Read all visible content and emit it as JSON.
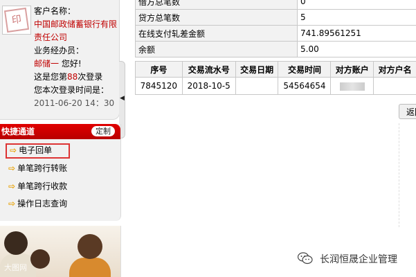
{
  "user": {
    "customer_label": "客户名称：",
    "customer_name": "中国邮政储蓄银行有限责任公司",
    "agent_label": "业务经办员：",
    "agent_name": "邮储一",
    "greeting": " 您好!",
    "visit_prefix": "这是您第",
    "visit_count": "88",
    "visit_suffix": "次登录",
    "last_login_label": "您本次登录时间是：",
    "last_login_time": "2011-06-20 14：30"
  },
  "quick_access": {
    "title": "快捷通道",
    "customize_label": "定制",
    "items": [
      {
        "label": "电子回单",
        "selected": true
      },
      {
        "label": "单笔跨行转账",
        "selected": false
      },
      {
        "label": "单笔跨行收款",
        "selected": false
      },
      {
        "label": "操作日志查询",
        "selected": false
      }
    ]
  },
  "photo": {
    "watermark": "大图网"
  },
  "summary": {
    "rows": [
      {
        "label": "借方总笔数",
        "value": "0"
      },
      {
        "label": "贷方总笔数",
        "value": "5"
      },
      {
        "label": "在线支付轧差金额",
        "value": "741.89561251"
      },
      {
        "label": "余额",
        "value": "5.00"
      }
    ]
  },
  "transactions": {
    "columns": [
      "序号",
      "交易流水号",
      "交易日期",
      "交易时间",
      "对方账户",
      "对方户名"
    ],
    "rows": [
      {
        "seq": "7845120",
        "serial": "2018-10-5",
        "date": "",
        "time": "54564654",
        "account": "",
        "name": ""
      }
    ]
  },
  "back_button": "返回",
  "watermark": {
    "text": "长润恒晟企业管理"
  },
  "colors": {
    "accent_red": "#c00000",
    "header_red": "#d40000"
  }
}
